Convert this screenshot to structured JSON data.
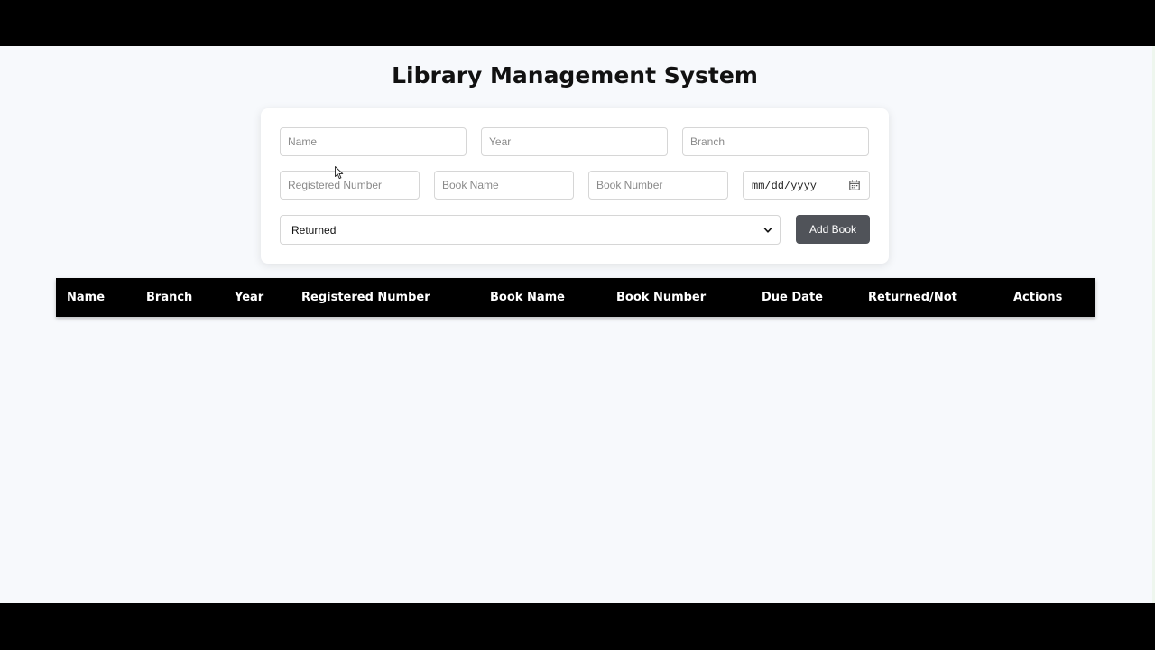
{
  "header": {
    "title": "Library Management System"
  },
  "form": {
    "name_placeholder": "Name",
    "year_placeholder": "Year",
    "branch_placeholder": "Branch",
    "registered_number_placeholder": "Registered Number",
    "book_name_placeholder": "Book Name",
    "book_number_placeholder": "Book Number",
    "due_date_placeholder": "mm/dd/yyyy",
    "status_value": "Returned",
    "add_button_label": "Add Book",
    "icons": [
      "calendar-icon",
      "chevron-down-icon"
    ]
  },
  "table": {
    "columns": [
      "Name",
      "Branch",
      "Year",
      "Registered Number",
      "Book Name",
      "Book Number",
      "Due Date",
      "Returned/Not",
      "Actions"
    ],
    "rows": []
  },
  "colors": {
    "page_background": "#f7f9fc",
    "table_header": "#000000",
    "button": "#505359"
  }
}
